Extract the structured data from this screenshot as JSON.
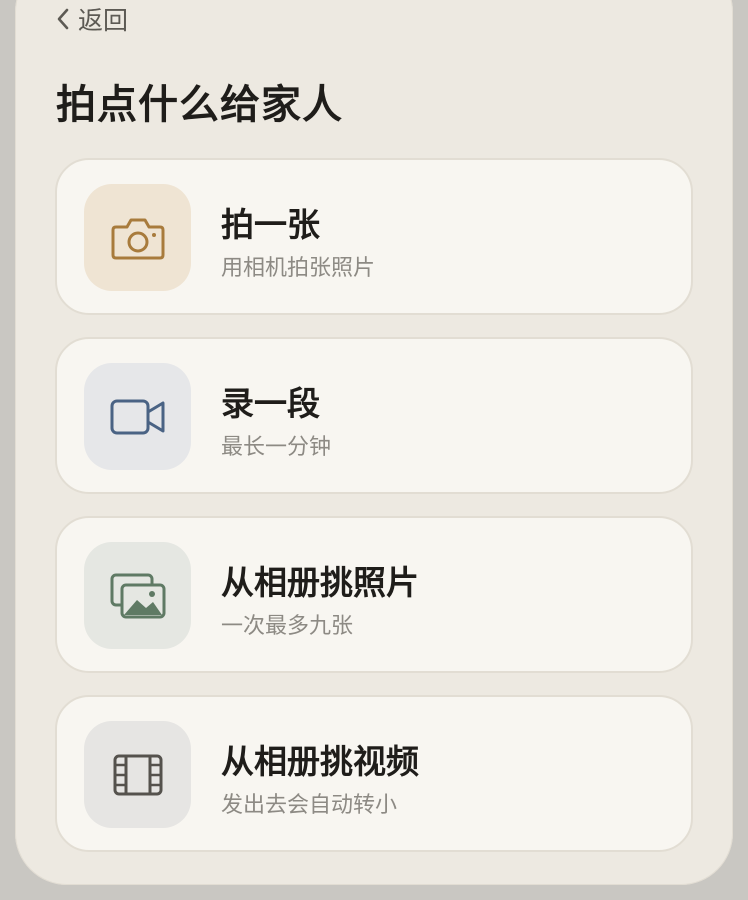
{
  "header": {
    "back_label": "返回",
    "title": "拍点什么给家人"
  },
  "options": [
    {
      "icon": "camera-icon",
      "title": "拍一张",
      "subtitle": "用相机拍张照片",
      "color": "#a87b3c"
    },
    {
      "icon": "video-camera-icon",
      "title": "录一段",
      "subtitle": "最长一分钟",
      "color": "#4a6384"
    },
    {
      "icon": "photo-album-icon",
      "title": "从相册挑照片",
      "subtitle": "一次最多九张",
      "color": "#5f7a64"
    },
    {
      "icon": "film-icon",
      "title": "从相册挑视频",
      "subtitle": "发出去会自动转小",
      "color": "#55524d"
    }
  ]
}
